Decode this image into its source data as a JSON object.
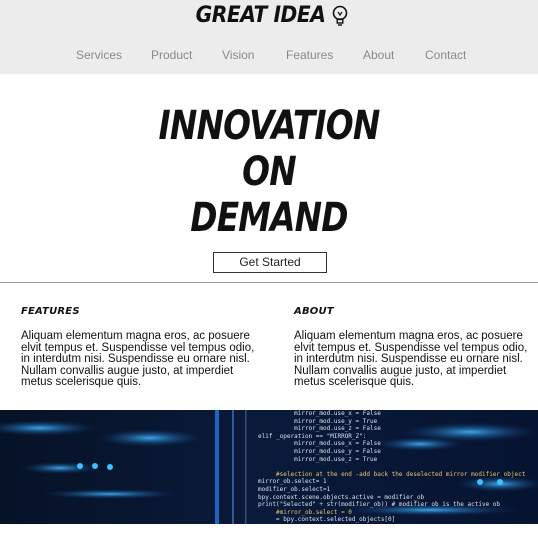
{
  "header": {
    "logo_text": "GREAT IDEA",
    "logo_icon": "lightbulb-icon"
  },
  "nav": {
    "items": [
      {
        "label": "Services"
      },
      {
        "label": "Product"
      },
      {
        "label": "Vision"
      },
      {
        "label": "Features"
      },
      {
        "label": "About"
      },
      {
        "label": "Contact"
      }
    ]
  },
  "hero": {
    "line1": "INNOVATION",
    "line2": "ON",
    "line3": "DEMAND",
    "cta_label": "Get Started"
  },
  "features": {
    "heading": "FEATURES",
    "body": "Aliquam elementum magna eros, ac posuere elvit tempus et. Suspendisse vel tempus odio, in interdutm nisi. Suspendisse eu ornare nisl. Nullam convallis augue justo, at imperdiet metus scelerisque quis."
  },
  "about": {
    "heading": "ABOUT",
    "body": "Aliquam elementum magna eros, ac posuere elvit tempus et. Suspendisse vel tempus odio, in interdutm nisi. Suspendisse eu ornare nisl. Nullam convallis augue justo, at imperdiet metus scelerisque quis."
  },
  "banner": {
    "code_lines": [
      "          mirror_mod.use_x = False",
      "          mirror_mod.use_y = True",
      "          mirror_mod.use_z = False",
      "elif _operation == \"MIRROR_Z\":",
      "          mirror_mod.use_x = False",
      "          mirror_mod.use_y = False",
      "          mirror_mod.use_z = True",
      "",
      "     #selection at the end -add back the deselected mirror modifier object",
      "mirror_ob.select= 1",
      "modifier_ob.select=1",
      "bpy.context.scene.objects.active = modifier_ob",
      "print(\"Selected\" + str(modifier_ob)) # modifier ob is the active ob",
      "     #mirror_ob.select = 0",
      "     = bpy.context.selected_objects[0]"
    ]
  }
}
